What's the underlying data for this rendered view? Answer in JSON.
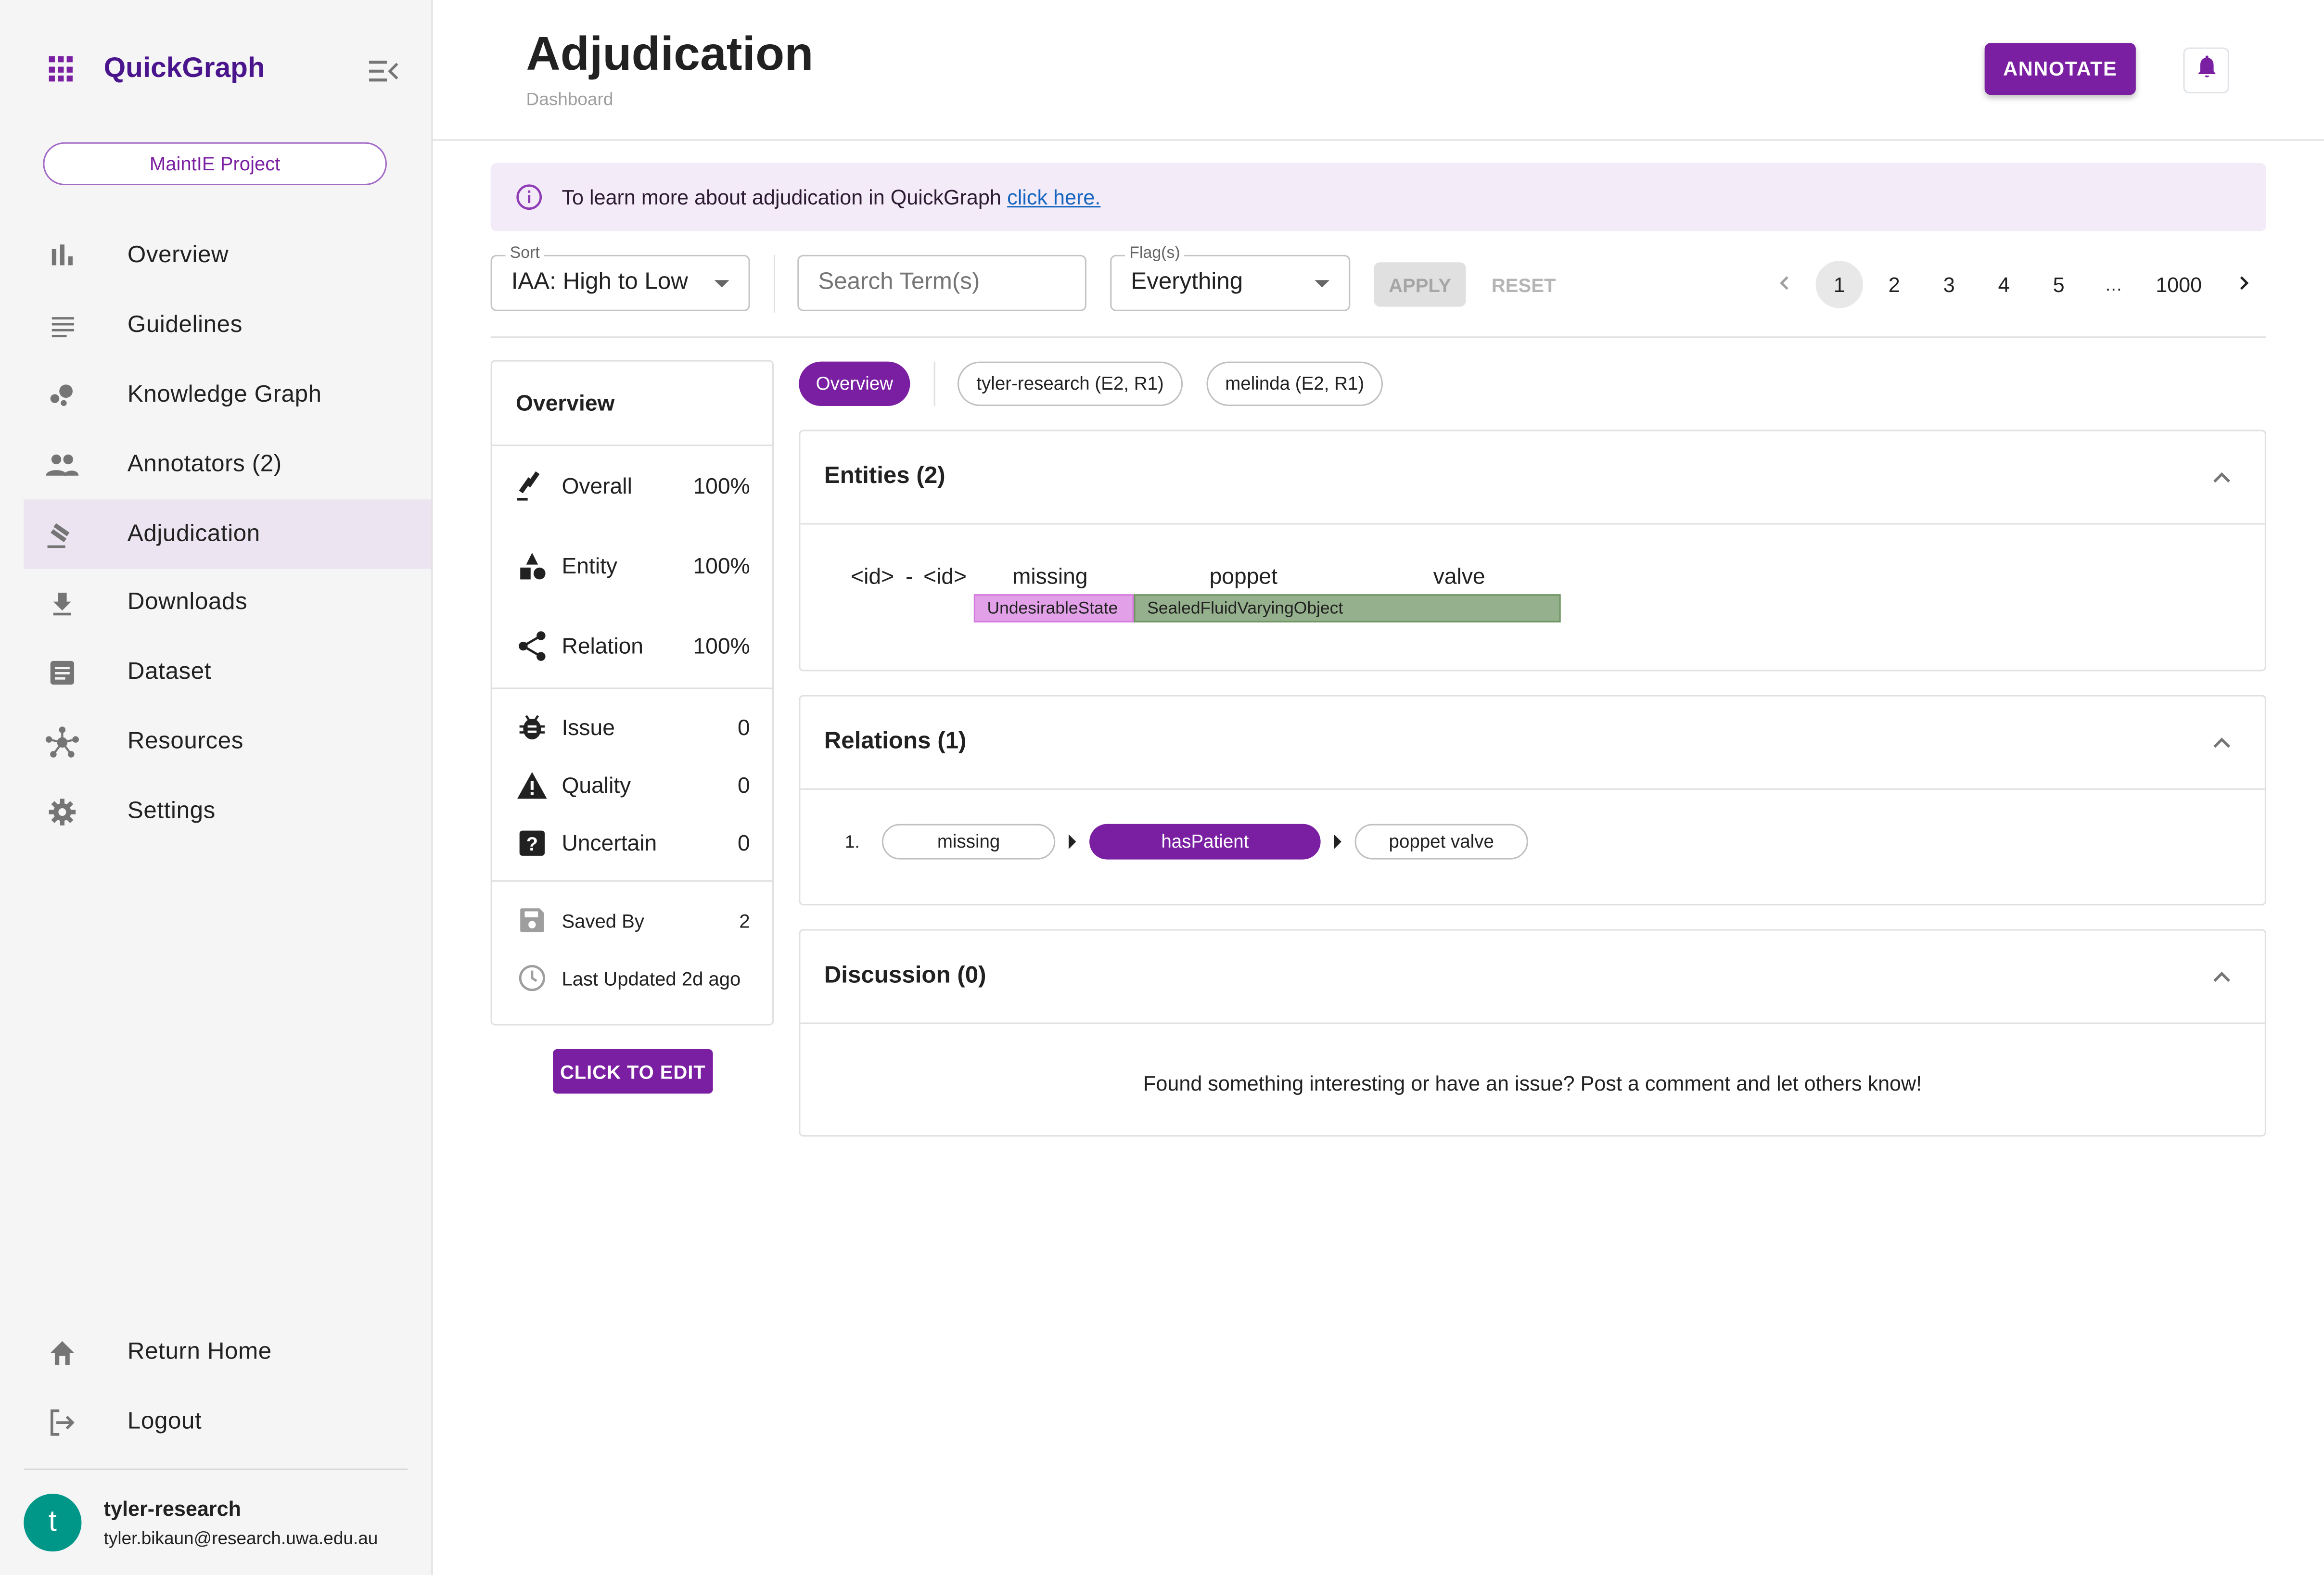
{
  "sidebar": {
    "brand": "QuickGraph",
    "project": "MaintIE Project",
    "items": [
      {
        "label": "Overview",
        "icon": "bar-chart-icon"
      },
      {
        "label": "Guidelines",
        "icon": "notes-icon"
      },
      {
        "label": "Knowledge Graph",
        "icon": "bubble-chart-icon"
      },
      {
        "label": "Annotators (2)",
        "icon": "people-icon"
      },
      {
        "label": "Adjudication",
        "icon": "gavel-icon",
        "active": true
      },
      {
        "label": "Downloads",
        "icon": "download-icon"
      },
      {
        "label": "Dataset",
        "icon": "article-icon"
      },
      {
        "label": "Resources",
        "icon": "hub-icon"
      },
      {
        "label": "Settings",
        "icon": "gear-icon"
      }
    ],
    "bottom": [
      {
        "label": "Return Home",
        "icon": "home-icon"
      },
      {
        "label": "Logout",
        "icon": "logout-icon"
      }
    ],
    "user": {
      "initial": "t",
      "name": "tyler-research",
      "email": "tyler.bikaun@research.uwa.edu.au"
    }
  },
  "header": {
    "title": "Adjudication",
    "subtitle": "Dashboard",
    "annotate_label": "ANNOTATE"
  },
  "info": {
    "text": "To learn more about adjudication in QuickGraph",
    "link": "click here."
  },
  "filters": {
    "sort_label": "Sort",
    "sort_value": "IAA: High to Low",
    "search_placeholder": "Search Term(s)",
    "search_value": "",
    "flags_label": "Flag(s)",
    "flags_value": "Everything",
    "apply_label": "APPLY",
    "reset_label": "RESET"
  },
  "pagination": {
    "current": 1,
    "pages": [
      "1",
      "2",
      "3",
      "4",
      "5",
      "…",
      "1000"
    ]
  },
  "overview": {
    "title": "Overview",
    "agreement": [
      {
        "label": "Overall",
        "value": "100%",
        "icon": "gavel-icon"
      },
      {
        "label": "Entity",
        "value": "100%",
        "icon": "category-icon"
      },
      {
        "label": "Relation",
        "value": "100%",
        "icon": "share-icon"
      }
    ],
    "flags": [
      {
        "label": "Issue",
        "value": "0",
        "icon": "bug-icon"
      },
      {
        "label": "Quality",
        "value": "0",
        "icon": "warning-icon"
      },
      {
        "label": "Uncertain",
        "value": "0",
        "icon": "help-box-icon"
      }
    ],
    "saved_by_label": "Saved By",
    "saved_by_value": "2",
    "last_updated": "Last Updated 2d ago",
    "edit_label": "CLICK TO EDIT"
  },
  "tabs": [
    {
      "label": "Overview",
      "active": true
    },
    {
      "label": "tyler-research (E2, R1)"
    },
    {
      "label": "melinda (E2, R1)"
    }
  ],
  "entities": {
    "title": "Entities (2)",
    "tokens": [
      "<id>",
      "-",
      "<id>",
      "missing",
      "poppet",
      "valve"
    ],
    "tags": [
      {
        "label": "UndesirableState",
        "color": "#e2a0e8",
        "border": "#d47bdf"
      },
      {
        "label": "SealedFluidVaryingObject",
        "color": "#95b08c",
        "border": "#6f9663"
      }
    ]
  },
  "relations": {
    "title": "Relations (1)",
    "items": [
      {
        "index": "1.",
        "source": "missing",
        "relation": "hasPatient",
        "target": "poppet valve"
      }
    ]
  },
  "discussion": {
    "title": "Discussion (0)",
    "empty_text": "Found something interesting or have an issue? Post a comment and let others know!"
  },
  "colors": {
    "accent": "#7b1fa2",
    "brand_text": "#4a148c",
    "avatar": "#009688",
    "info_bg": "#f3ebf7"
  }
}
